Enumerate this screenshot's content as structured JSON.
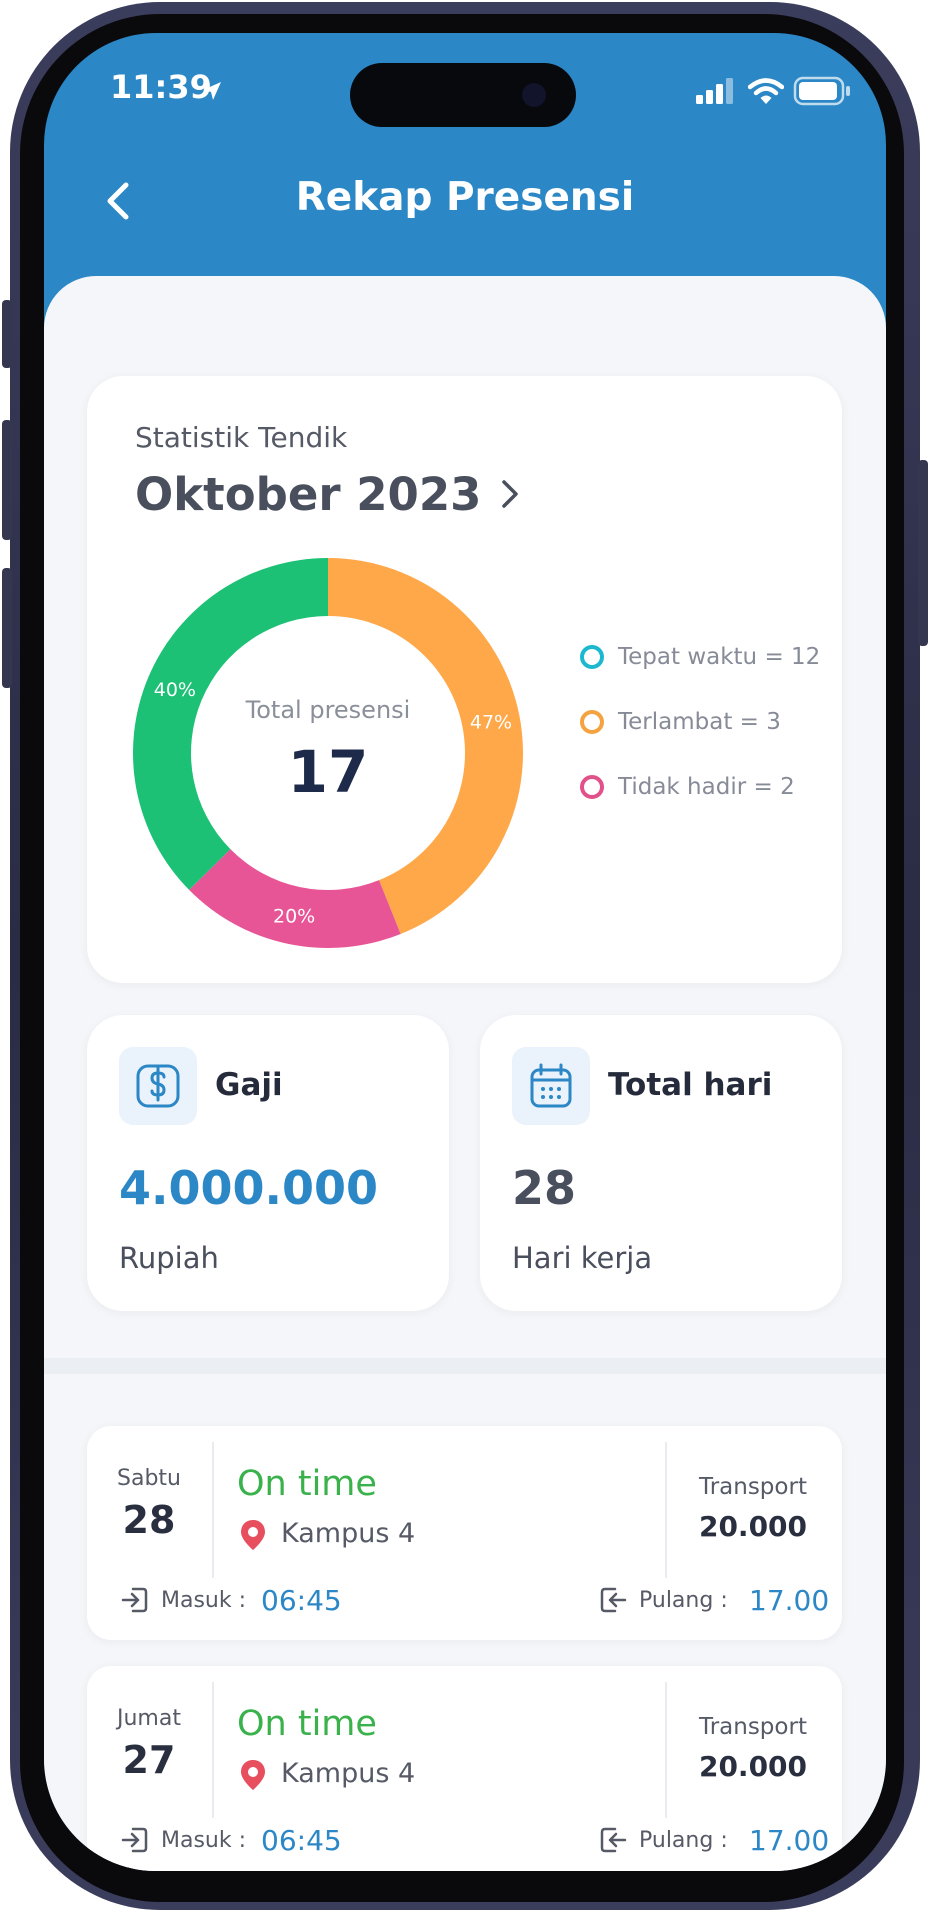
{
  "status_bar": {
    "time": "11:39"
  },
  "header": {
    "title": "Rekap Presensi"
  },
  "stats": {
    "subtitle": "Statistik Tendik",
    "month": "Oktober 2023",
    "center_label": "Total presensi",
    "center_value": "17"
  },
  "chart_data": {
    "type": "pie",
    "series": [
      {
        "name": "Tepat waktu",
        "value": 47,
        "label": "47%",
        "color": "#ffa84a"
      },
      {
        "name": "Tidak hadir",
        "value": 20,
        "label": "20%",
        "color": "#e85596"
      },
      {
        "name": "Terlambat",
        "value": 40,
        "label": "40%",
        "color": "#1cc175"
      }
    ]
  },
  "legend": [
    {
      "label": "Tepat waktu = 12",
      "color": "#1bb8cf"
    },
    {
      "label": "Terlambat = 3",
      "color": "#f5a340"
    },
    {
      "label": "Tidak hadir = 2",
      "color": "#e2528a"
    }
  ],
  "gaji": {
    "title": "Gaji",
    "value": "4.000.000",
    "unit": "Rupiah"
  },
  "total_hari": {
    "title": "Total hari",
    "value": "28",
    "unit": "Hari kerja"
  },
  "records": [
    {
      "day": "Sabtu",
      "date": "28",
      "status": "On time",
      "location": "Kampus 4",
      "transport_label": "Transport",
      "transport_value": "20.000",
      "in_label": "Masuk :",
      "in_time": "06:45",
      "out_label": "Pulang :",
      "out_time": "17.00"
    },
    {
      "day": "Jumat",
      "date": "27",
      "status": "On time",
      "location": "Kampus 4",
      "transport_label": "Transport",
      "transport_value": "20.000",
      "in_label": "Masuk :",
      "in_time": "06:45",
      "out_label": "Pulang :",
      "out_time": "17.00"
    }
  ],
  "colors": {
    "primary": "#2b87c5",
    "success": "#3ab24b",
    "text": "#2a2f40"
  }
}
